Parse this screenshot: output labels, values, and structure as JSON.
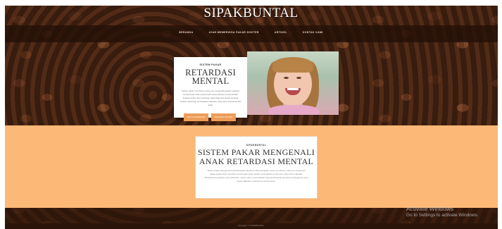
{
  "brand": {
    "title": "SIPAKBUNTAL"
  },
  "nav": {
    "items": [
      "BERANDA",
      "AYAH MEMERIKSA PAKAR DOKTER",
      "ARTIKEL",
      "KONTAK KAMI"
    ]
  },
  "hero": {
    "kicker": "SISTEM PAKAR",
    "title_line1": "RETARDASI",
    "title_line2": "MENTAL",
    "description": "Sistem pakar membantu orang tua mengenali gejala retardasi mental pada anak secara lebih awal sebelum berkonsultasi kepada dokter atau psikolog. Hasil diagnosa dapat menjadi rujukan awal bagi penanganan lanjutan yang tepat sesuai kondisi anak.",
    "buttons": [
      "MULAI DIAGNOSA",
      "TENTANG SISTEM"
    ]
  },
  "about": {
    "kicker": "SIPAKBUNTAL",
    "title_line1": "SISTEM PAKAR MENGENALI",
    "title_line2": "ANAK RETARDASI MENTAL",
    "description": "Sistem Pakar Mengenali Anak Retardasi Mental ini dikembangkan untuk membantu orang tua mengenali gejala-gejala awal retardasi mental pada anak melalui serangkaian pertanyaan yang harus dijawab. Berdasarkan jawaban yang diberikan, sistem akan menampilkan hasil analisa beserta saran penanganan yang dapat dilakukan selanjutnya secara tepat."
  },
  "footer": {
    "text": "Copyright © SIPAKBUNTAL"
  },
  "watermark": {
    "line1": "Activate Windows",
    "line2": "Go to Settings to activate Windows."
  },
  "colors": {
    "orange_band": "#fcb876",
    "button": "#ee9d57",
    "dark_coffee": "#3e1f10"
  }
}
